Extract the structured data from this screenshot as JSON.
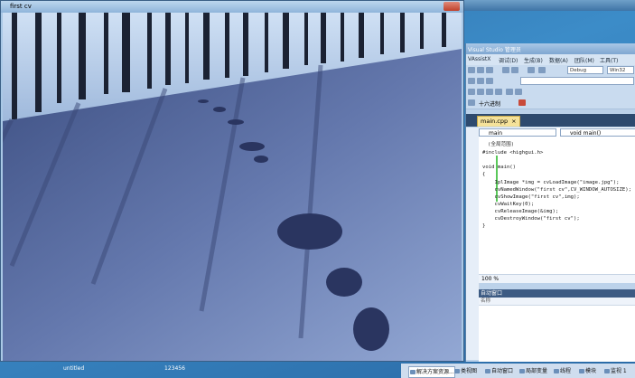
{
  "image_window": {
    "title": "first cv"
  },
  "vs": {
    "title": "Visual Studio 管理员",
    "menu": [
      "VAssistX",
      "调试(D)",
      "生成(B)",
      "数据(A)",
      "团队(M)",
      "工具(T)"
    ],
    "config_combo": "Debug",
    "platform_combo": "Win32",
    "toolbar2_label": "十六进制",
    "tab_label": "main.cpp",
    "tab_close": "×",
    "nav_scope": "main",
    "nav_function": "void main()",
    "scope_label": "(全局范围)",
    "code": [
      "#include <highgui.h>",
      "",
      "void main()",
      "{",
      "    IplImage *img = cvLoadImage(\"image.jpg\");",
      "    cvNamedWindow(\"first cv\",CV_WINDOW_AUTOSIZE);",
      "    cvShowImage(\"first cv\",img);",
      "    cvWaitKey(0);",
      "    cvReleaseImage(&img);",
      "    cvDestroyWindow(\"first cv\");",
      "}"
    ],
    "zoom": "100 %",
    "auto_window_title": "自动窗口",
    "auto_window_column": "名称"
  },
  "desktop": {
    "labels": [
      "untitled",
      "123456"
    ]
  },
  "bottom_tabs": [
    "解决方案资源...",
    "类视图",
    "自动窗口",
    "局部变量",
    "线程",
    "模块",
    "监视 1"
  ],
  "colors": {
    "tab_active": "#f5e29a",
    "editor_bg": "#ffffff",
    "keyword": "#1a3fd6"
  }
}
